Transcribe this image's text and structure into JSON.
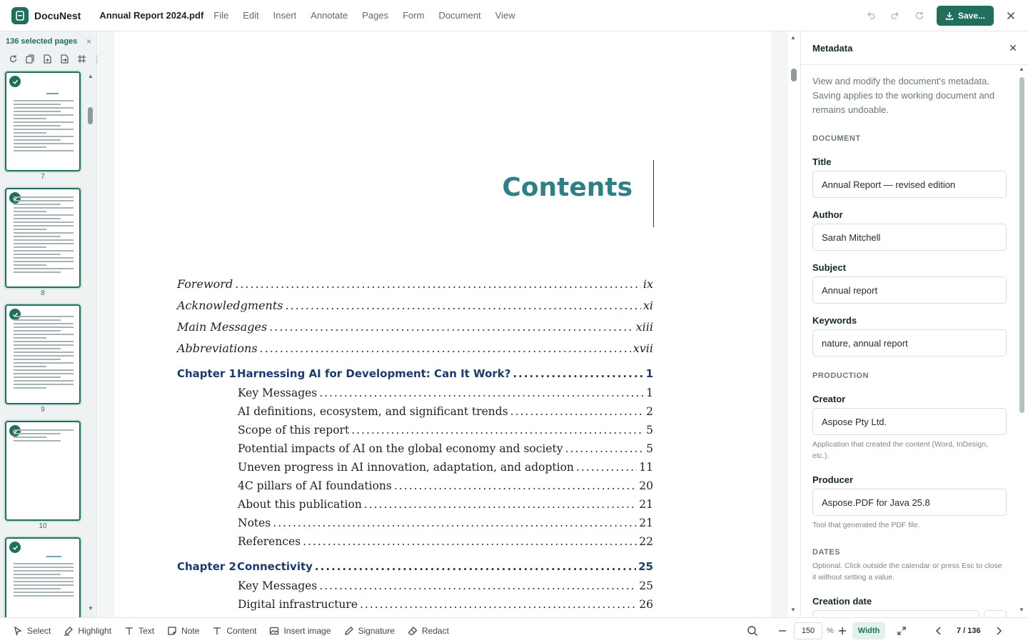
{
  "app": {
    "name": "DocuNest",
    "document_title": "Annual Report 2024.pdf",
    "menu": [
      "File",
      "Edit",
      "Insert",
      "Annotate",
      "Pages",
      "Form",
      "Document",
      "View"
    ],
    "save_label": "Save...",
    "accent": "#1f6f5c"
  },
  "thumbnails": {
    "selection_label": "136 selected pages",
    "pages": [
      "7",
      "8",
      "9",
      "10"
    ]
  },
  "document": {
    "heading": "Contents",
    "front_matter": [
      {
        "label": "Foreword",
        "page": "ix"
      },
      {
        "label": "Acknowledgments",
        "page": "xi"
      },
      {
        "label": "Main Messages",
        "page": "xiii"
      },
      {
        "label": "Abbreviations",
        "page": "xvii"
      }
    ],
    "chapter1": {
      "number": "Chapter 1",
      "title": "Harnessing AI for Development: Can It Work?",
      "page": "1"
    },
    "chapter1_sections": [
      {
        "label": "Key Messages",
        "page": "1"
      },
      {
        "label": "AI definitions, ecosystem, and significant trends",
        "page": "2"
      },
      {
        "label": "Scope of this report",
        "page": "5"
      },
      {
        "label": "Potential impacts of AI on the global economy and society",
        "page": "5"
      },
      {
        "label": "Uneven progress in AI innovation, adaptation, and adoption",
        "page": "11"
      },
      {
        "label": "4C pillars of AI foundations",
        "page": "20"
      },
      {
        "label": "About this publication",
        "page": "21"
      },
      {
        "label": "Notes",
        "page": "21"
      },
      {
        "label": "References",
        "page": "22"
      }
    ],
    "chapter2": {
      "number": "Chapter 2",
      "title": "Connectivity",
      "page": "25"
    },
    "chapter2_sections": [
      {
        "label": "Key Messages",
        "page": "25"
      },
      {
        "label": "Digital infrastructure",
        "page": "26"
      }
    ]
  },
  "metadata": {
    "title": "Metadata",
    "intro": "View and modify the document's metadata. Saving applies to the working document and remains undoable.",
    "section_document": "DOCUMENT",
    "title_label": "Title",
    "title_value": "Annual Report — revised edition",
    "author_label": "Author",
    "author_value": "Sarah Mitchell",
    "subject_label": "Subject",
    "subject_value": "Annual report",
    "keywords_label": "Keywords",
    "keywords_value": "nature, annual report",
    "section_production": "PRODUCTION",
    "creator_label": "Creator",
    "creator_value": "Aspose Pty Ltd.",
    "creator_help": "Application that created the content (Word, InDesign, etc.).",
    "producer_label": "Producer",
    "producer_value": "Aspose.PDF for Java 25.8",
    "producer_help": "Tool that generated the PDF file.",
    "section_dates": "DATES",
    "dates_help": "Optional. Click outside the calendar or press Esc to close it without setting a value.",
    "creation_date_label": "Creation date"
  },
  "toolbar": {
    "tools": [
      "Select",
      "Highlight",
      "Text",
      "Note",
      "Content",
      "Insert image",
      "Signature",
      "Redact"
    ],
    "zoom_value": "150",
    "zoom_unit": "%",
    "fit_label": "Width",
    "page_indicator": "7 / 136"
  }
}
